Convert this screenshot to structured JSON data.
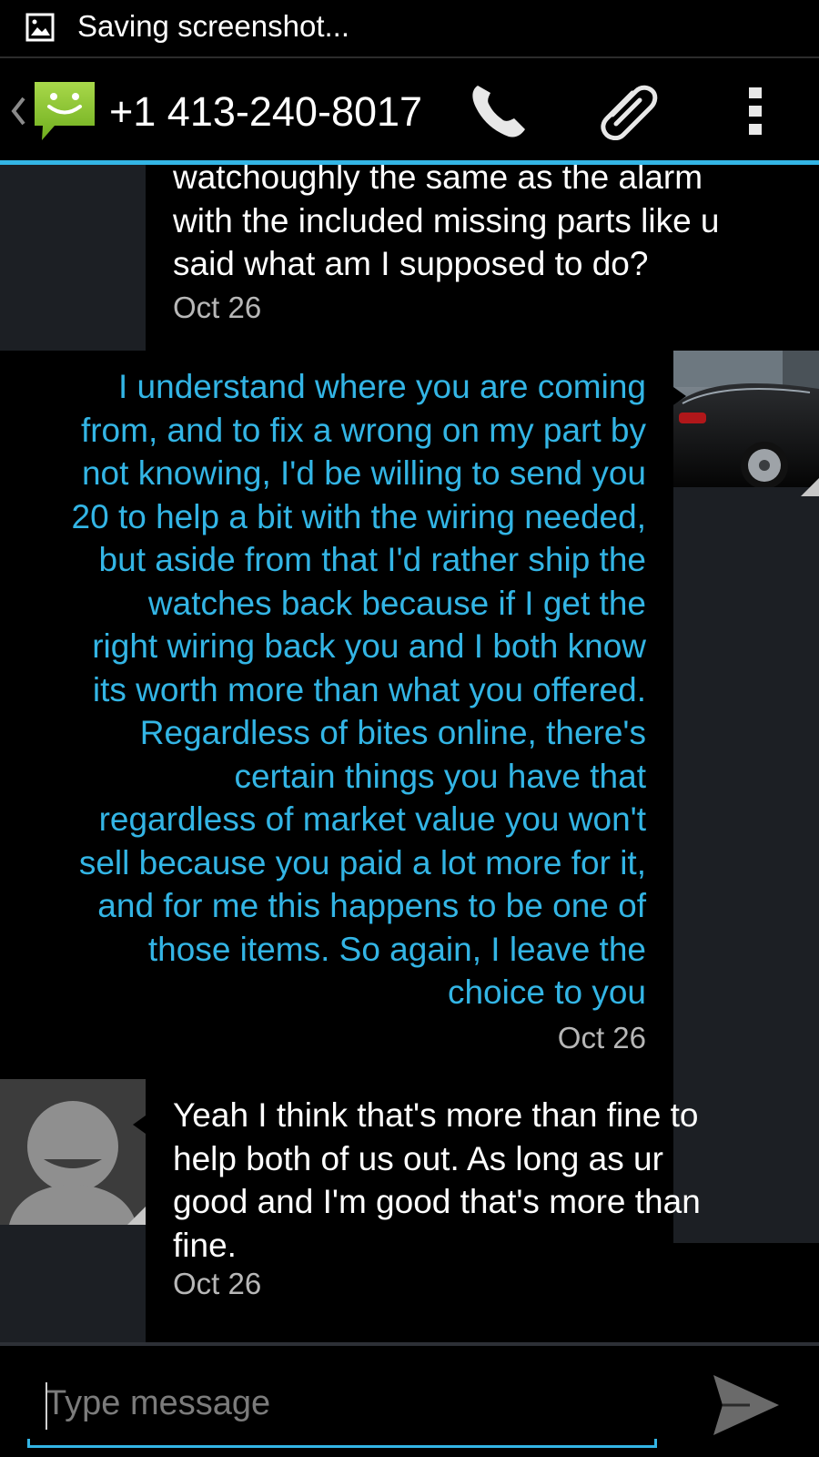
{
  "status_bar": {
    "notification_icon": "image-icon",
    "text": "Saving screenshot..."
  },
  "action_bar": {
    "back_icon": "chevron-left-icon",
    "app_icon": "sms-smiley-icon",
    "title": "+1 413-240-8017",
    "actions": [
      {
        "name": "call",
        "icon": "phone-icon"
      },
      {
        "name": "attach",
        "icon": "paperclip-icon"
      },
      {
        "name": "overflow",
        "icon": "overflow-menu-icon"
      }
    ],
    "accent_color": "#33b5e5"
  },
  "messages": [
    {
      "direction": "incoming",
      "text": "watchoughly the same as the alarm\nwith the included missing parts  like u\nsaid what am I supposed to do?",
      "date": "Oct 26"
    },
    {
      "direction": "outgoing",
      "text": "I understand where you are coming\nfrom, and to fix a wrong on my part by\nnot knowing, I'd be willing to send you\n20 to help a bit with the wiring needed,\nbut aside from that I'd rather ship the\nwatches back because if I get the\nright wiring back you and I both know\nits worth more than what you offered.\nRegardless of bites online, there's\ncertain things you have that\nregardless of market value you won't\nsell because you paid a lot more for it,\nand for me this happens to be one of\nthose items. So again, I leave the\nchoice to you ",
      "date": "Oct 26",
      "avatar": "car-photo"
    },
    {
      "direction": "incoming",
      "text": "Yeah I think that's more than fine to\nhelp both of us out. As long as ur\ngood and I'm good that's more than\nfine.",
      "date": "Oct 26",
      "avatar": "default-contact-avatar"
    }
  ],
  "compose": {
    "placeholder": "Type message",
    "value": "",
    "send_icon": "send-icon"
  }
}
